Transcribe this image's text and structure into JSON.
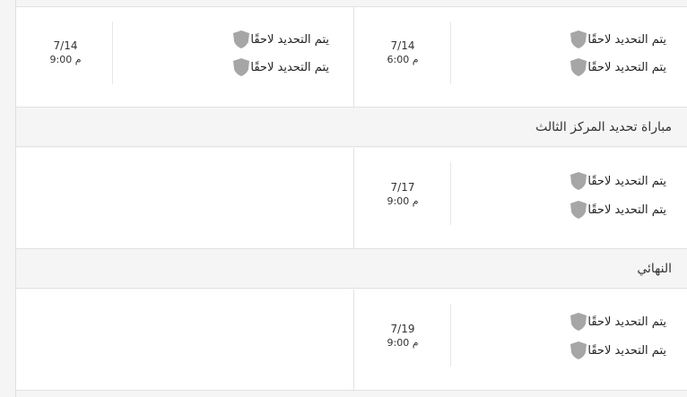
{
  "tbd": "يتم التحديد لاحقًا",
  "round1": {
    "match_right": {
      "date": "7/14",
      "time": "6:00 م"
    },
    "match_left": {
      "date": "7/14",
      "time": "9:00 م"
    }
  },
  "third_place": {
    "title": "مباراة تحديد المركز الثالث",
    "match": {
      "date": "7/17",
      "time": "9:00 م"
    }
  },
  "final": {
    "title": "النهائي",
    "match": {
      "date": "7/19",
      "time": "9:00 م"
    }
  },
  "colors": {
    "shield": "#a6a6a6",
    "card": "#ffffff",
    "header_bg": "#f5f5f5",
    "border": "#e2e2e2"
  }
}
